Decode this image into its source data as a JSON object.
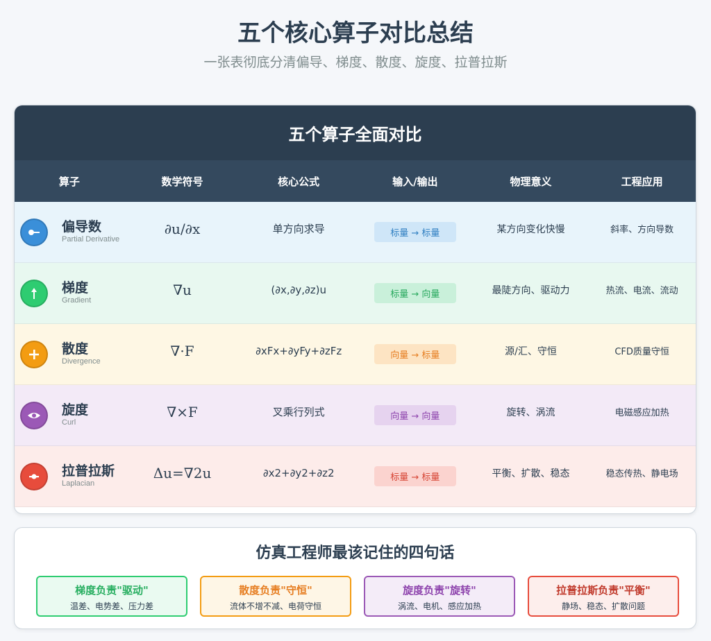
{
  "header": {
    "title": "五个核心算子对比总结",
    "subtitle": "一张表彻底分清偏导、梯度、散度、旋度、拉普拉斯"
  },
  "table": {
    "title": "五个算子全面对比",
    "columns": [
      "算子",
      "数学符号",
      "核心公式",
      "输入/输出",
      "物理意义",
      "工程应用"
    ],
    "rows": [
      {
        "name": "偏导数",
        "en": "Partial Derivative",
        "symbol": "∂u/∂x",
        "formula": "单方向求导",
        "io": "标量 → 标量",
        "meaning": "某方向变化快慢",
        "app": "斜率、方向导数",
        "bg": "#e8f4fb",
        "icon_color": "#3a8fd9",
        "badge_bg": "#cfe6f8",
        "badge_fg": "#2f7fc1",
        "icon": "key-icon"
      },
      {
        "name": "梯度",
        "en": "Gradient",
        "symbol": "∇u",
        "formula": "(∂x,∂y,∂z)u",
        "io": "标量 → 向量",
        "meaning": "最陡方向、驱动力",
        "app": "热流、电流、流动",
        "bg": "#e8f8f0",
        "icon_color": "#2ecc71",
        "badge_bg": "#c9f0da",
        "badge_fg": "#27a85d",
        "icon": "arrow-up-icon"
      },
      {
        "name": "散度",
        "en": "Divergence",
        "symbol": "∇·F",
        "formula": "∂xFx+∂yFy+∂zFz",
        "io": "向量 → 标量",
        "meaning": "源/汇、守恒",
        "app": "CFD质量守恒",
        "bg": "#fef7e4",
        "icon_color": "#f39c12",
        "badge_bg": "#fde4c3",
        "badge_fg": "#e67e22",
        "icon": "plus-icon"
      },
      {
        "name": "旋度",
        "en": "Curl",
        "symbol": "∇×F",
        "formula": "叉乘行列式",
        "io": "向量 → 向量",
        "meaning": "旋转、涡流",
        "app": "电磁感应加热",
        "bg": "#f3eaf7",
        "icon_color": "#9b59b6",
        "badge_bg": "#e6d3ef",
        "badge_fg": "#8e44ad",
        "icon": "eye-icon"
      },
      {
        "name": "拉普拉斯",
        "en": "Laplacian",
        "symbol": "Δu=∇2u",
        "formula": "∂x2+∂y2+∂z2",
        "io": "标量 → 标量",
        "meaning": "平衡、扩散、稳态",
        "app": "稳态传热、静电场",
        "bg": "#fdecea",
        "icon_color": "#e74c3c",
        "badge_bg": "#fbd3cf",
        "badge_fg": "#d64333",
        "icon": "dot-line-icon"
      }
    ]
  },
  "summary": {
    "title": "仿真工程师最该记住的四句话",
    "tips": [
      {
        "title": "梯度负责\"驱动\"",
        "desc": "温差、电势差、压力差",
        "color": "#2ecc71",
        "bg": "#eafaf1",
        "title_color": "#27ae60"
      },
      {
        "title": "散度负责\"守恒\"",
        "desc": "流体不增不减、电荷守恒",
        "color": "#f39c12",
        "bg": "#fef6e6",
        "title_color": "#e67e22"
      },
      {
        "title": "旋度负责\"旋转\"",
        "desc": "涡流、电机、感应加热",
        "color": "#9b59b6",
        "bg": "#f4ecf8",
        "title_color": "#8e44ad"
      },
      {
        "title": "拉普拉斯负责\"平衡\"",
        "desc": "静场、稳态、扩散问题",
        "color": "#e74c3c",
        "bg": "#fdeeec",
        "title_color": "#c0392b"
      }
    ]
  }
}
